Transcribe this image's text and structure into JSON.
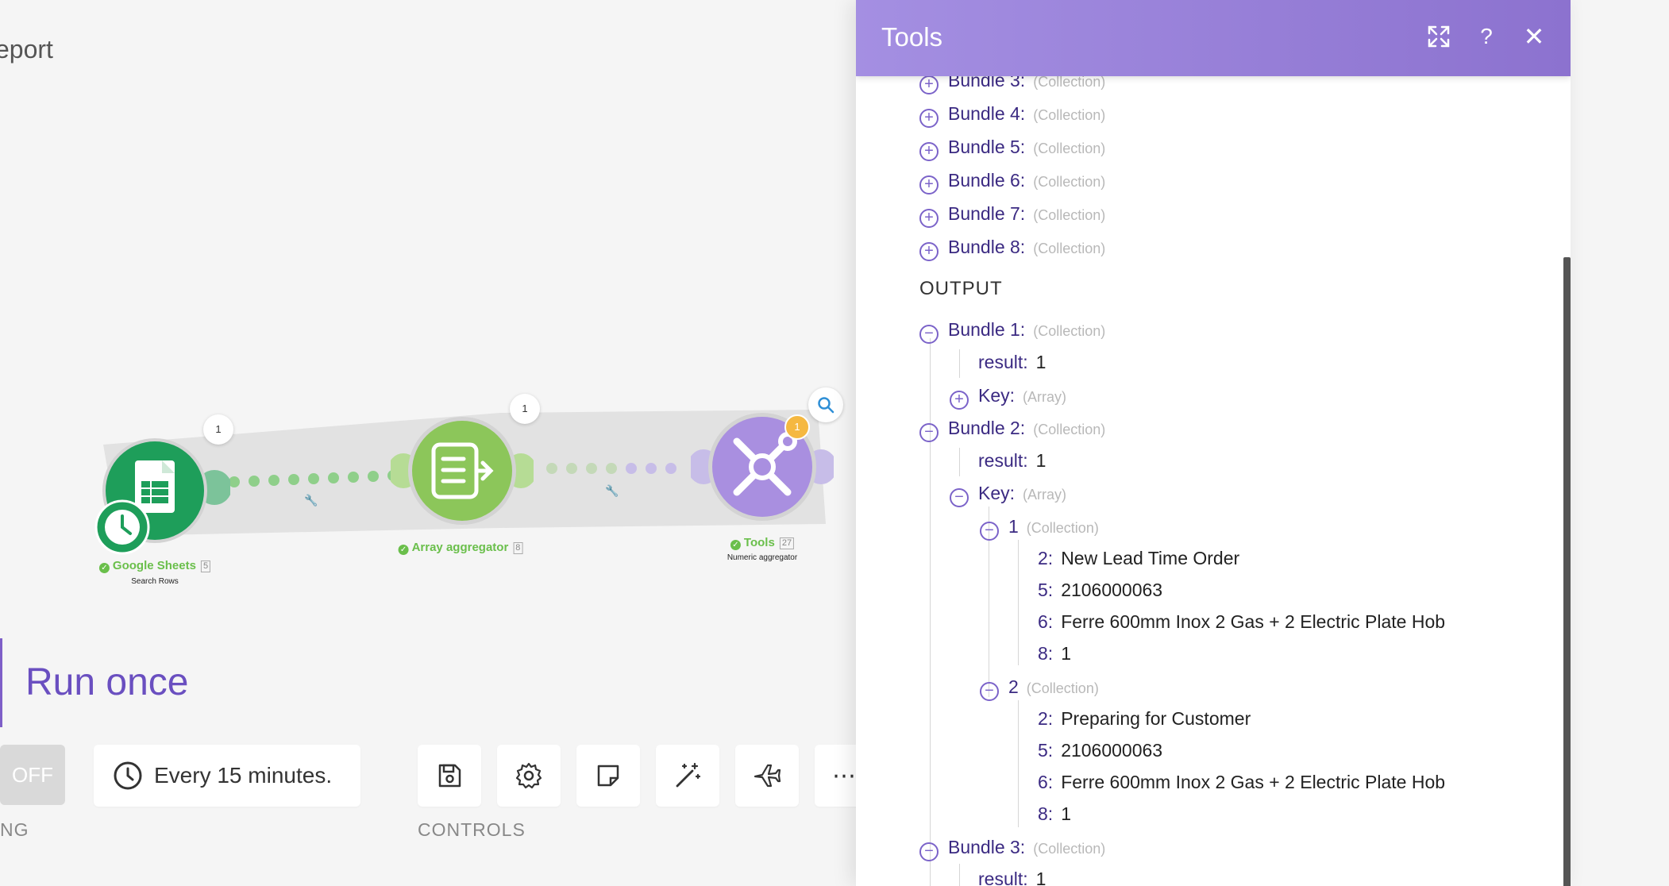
{
  "scenario_title": "eport",
  "modules": [
    {
      "name": "Google Sheets",
      "count": "5",
      "subtitle": "Search Rows",
      "bubble": "1"
    },
    {
      "name": "Array aggregator",
      "count": "8",
      "subtitle": "",
      "bubble": "1"
    },
    {
      "name": "Tools",
      "count": "27",
      "subtitle": "Numeric aggregator",
      "badge": "1"
    }
  ],
  "run_once_label": "Run once",
  "toggle_label": "OFF",
  "schedule_label": "Every 15 minutes.",
  "scheduling_caption": "NG",
  "controls_caption": "CONTROLS",
  "colors": {
    "accent": "#8c72cf",
    "success": "#6abf4b",
    "sheets": "#1e9e5a",
    "aggregator": "#8cc65a",
    "tools": "#a98fe0"
  },
  "panel": {
    "title": "Tools",
    "header_icons": [
      "expand-icon",
      "help-icon",
      "close-icon"
    ],
    "input_bundles": [
      {
        "key": "Bundle 3:",
        "type": "(Collection)"
      },
      {
        "key": "Bundle 4:",
        "type": "(Collection)"
      },
      {
        "key": "Bundle 5:",
        "type": "(Collection)"
      },
      {
        "key": "Bundle 6:",
        "type": "(Collection)"
      },
      {
        "key": "Bundle 7:",
        "type": "(Collection)"
      },
      {
        "key": "Bundle 8:",
        "type": "(Collection)"
      }
    ],
    "output_heading": "OUTPUT",
    "output": {
      "b1_key": "Bundle 1:",
      "b1_type": "(Collection)",
      "b1_result_key": "result:",
      "b1_result_val": "1",
      "b1_keyarr": "Key:",
      "b1_keyarr_type": "(Array)",
      "b2_key": "Bundle 2:",
      "b2_type": "(Collection)",
      "b2_result_key": "result:",
      "b2_result_val": "1",
      "b2_keyarr": "Key:",
      "b2_keyarr_type": "(Array)",
      "item1_key": "1",
      "item1_type": "(Collection)",
      "item1_fields": [
        {
          "k": "2:",
          "v": "New Lead Time Order"
        },
        {
          "k": "5:",
          "v": "2106000063"
        },
        {
          "k": "6:",
          "v": "Ferre 600mm Inox 2 Gas + 2 Electric Plate Hob"
        },
        {
          "k": "8:",
          "v": "1"
        }
      ],
      "item2_key": "2",
      "item2_type": "(Collection)",
      "item2_fields": [
        {
          "k": "2:",
          "v": "Preparing for Customer"
        },
        {
          "k": "5:",
          "v": "2106000063"
        },
        {
          "k": "6:",
          "v": "Ferre 600mm Inox 2 Gas + 2 Electric Plate Hob"
        },
        {
          "k": "8:",
          "v": "1"
        }
      ],
      "b3_key": "Bundle 3:",
      "b3_type": "(Collection)",
      "b3_result_key": "result:",
      "b3_result_val": "1"
    }
  }
}
